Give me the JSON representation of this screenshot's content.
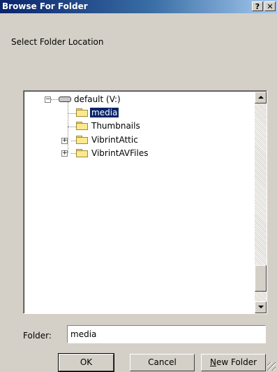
{
  "window": {
    "title": "Browse For Folder",
    "help_label": "?",
    "close_label": "✕"
  },
  "instruction": "Select Folder Location",
  "tree": {
    "root": {
      "label": "default (V:)",
      "icon": "drive-icon",
      "expanded": true
    },
    "children": [
      {
        "label": "media",
        "selected": true,
        "expandable": false
      },
      {
        "label": "Thumbnails",
        "selected": false,
        "expandable": false
      },
      {
        "label": "VibrintAttic",
        "selected": false,
        "expandable": true
      },
      {
        "label": "VibrintAVFiles",
        "selected": false,
        "expandable": true
      }
    ]
  },
  "folder_field": {
    "label": "Folder:",
    "value": "media"
  },
  "buttons": {
    "ok": "OK",
    "cancel": "Cancel",
    "new_folder_prefix": "N",
    "new_folder_rest": "ew Folder"
  },
  "colors": {
    "selection": "#0a246a",
    "dialog_face": "#d4d0c8",
    "title_gradient_start": "#0a246a"
  }
}
